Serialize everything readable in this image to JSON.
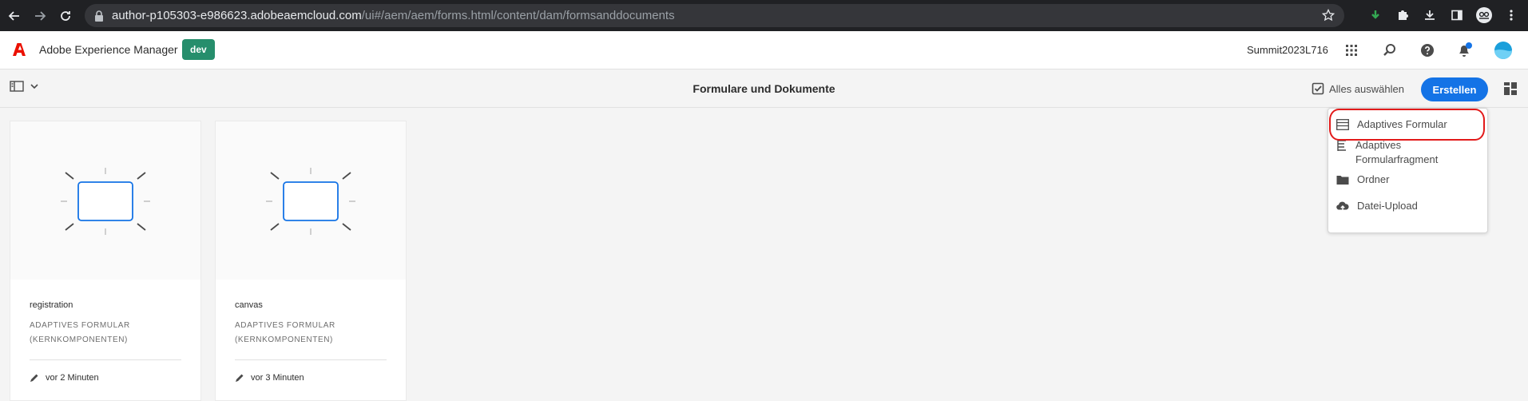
{
  "browser": {
    "url_host": "author-p105303-e986623.adobeaemcloud.com",
    "url_path": "/ui#/aem/aem/forms.html/content/dam/formsanddocuments"
  },
  "header": {
    "app_title": "Adobe Experience Manager",
    "env_badge": "dev",
    "org_name": "Summit2023L716"
  },
  "action_bar": {
    "title": "Formulare und Dokumente",
    "select_all_label": "Alles auswählen",
    "create_label": "Erstellen"
  },
  "cards": [
    {
      "name": "registration",
      "type": "ADAPTIVES FORMULAR (KERNKOMPONENTEN)",
      "modified": "vor 2 Minuten"
    },
    {
      "name": "canvas",
      "type": "ADAPTIVES FORMULAR (KERNKOMPONENTEN)",
      "modified": "vor 3 Minuten"
    }
  ],
  "create_menu": {
    "items": [
      {
        "label": "Adaptives Formular",
        "icon": "form-lines-icon"
      },
      {
        "label": "Adaptives Formularfragment",
        "icon": "form-fragment-icon"
      },
      {
        "label": "Ordner",
        "icon": "folder-icon"
      },
      {
        "label": "Datei-Upload",
        "icon": "upload-cloud-icon"
      }
    ]
  },
  "colors": {
    "accent": "#1473e6",
    "env_badge": "#268e6c",
    "highlight": "#e21a1a",
    "adobe_red": "#eb1000"
  }
}
